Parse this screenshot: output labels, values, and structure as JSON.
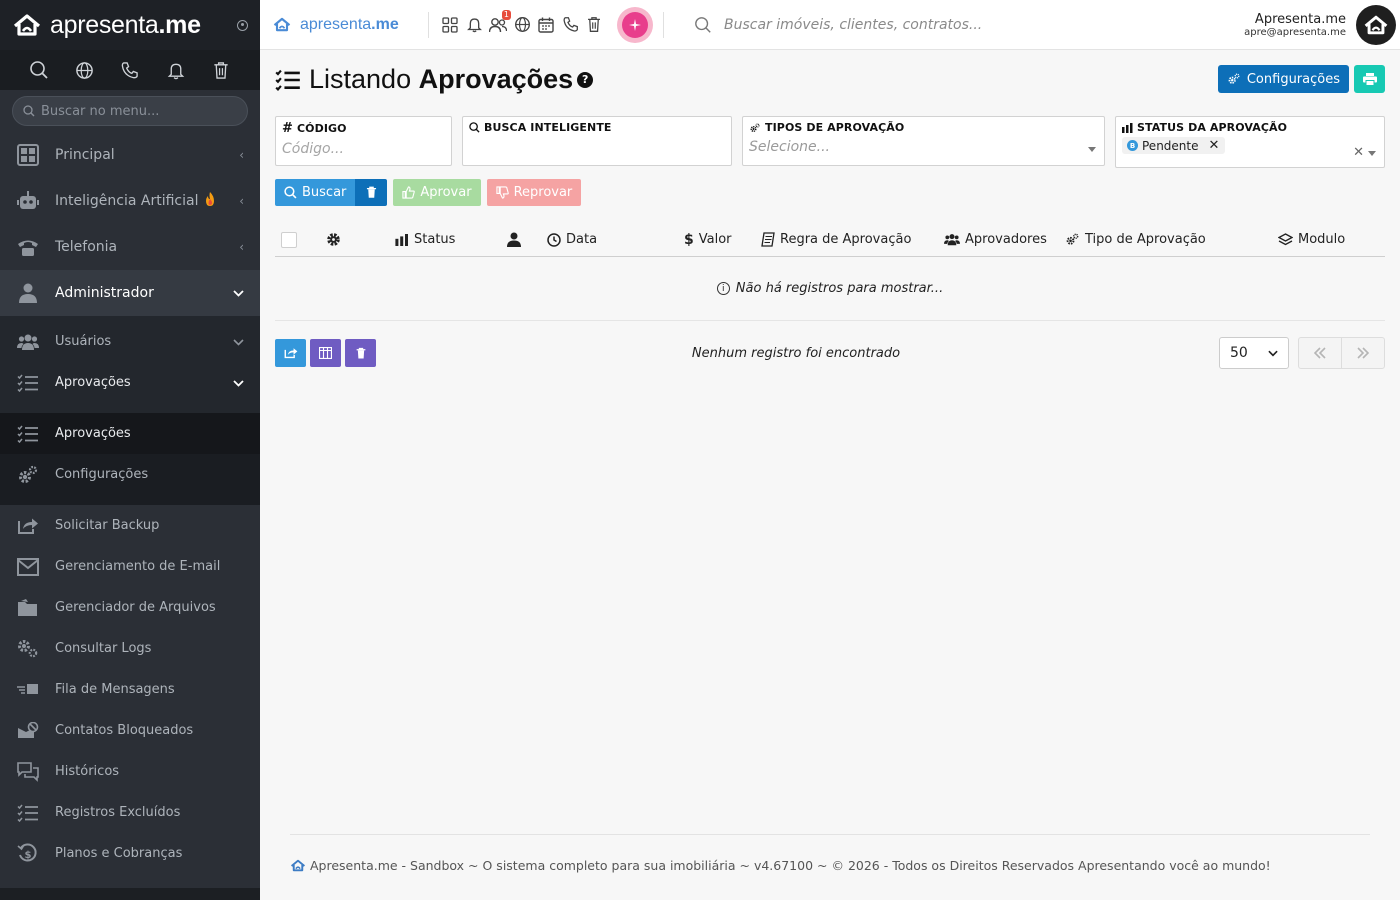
{
  "sidebar": {
    "brand": {
      "name_light": "apresenta",
      "name_bold": ".me"
    },
    "search_placeholder": "Buscar no menu...",
    "menu": [
      {
        "label": "Principal",
        "icon": "dashboard-icon"
      },
      {
        "label": "Inteligência Artificial",
        "icon": "robot-icon"
      },
      {
        "label": "Telefonia",
        "icon": "phone-icon"
      },
      {
        "label": "Administrador",
        "icon": "admin-user-icon"
      }
    ],
    "admin_submenu": [
      {
        "label": "Usuários",
        "icon": "users-icon"
      },
      {
        "label": "Aprovações",
        "icon": "checklist-icon"
      }
    ],
    "approvals_submenu": [
      {
        "label": "Aprovações",
        "icon": "checklist-icon"
      },
      {
        "label": "Configurações",
        "icon": "cogs-icon"
      }
    ],
    "more_items": [
      {
        "label": "Solicitar Backup",
        "icon": "share-icon"
      },
      {
        "label": "Gerenciamento de E-mail",
        "icon": "mail-icon"
      },
      {
        "label": "Gerenciador de Arquivos",
        "icon": "folder-icon"
      },
      {
        "label": "Consultar Logs",
        "icon": "cogs-icon"
      },
      {
        "label": "Fila de Mensagens",
        "icon": "queue-icon"
      },
      {
        "label": "Contatos Bloqueados",
        "icon": "blocked-contact-icon"
      },
      {
        "label": "Históricos",
        "icon": "history-chat-icon"
      },
      {
        "label": "Registros Excluídos",
        "icon": "list-icon"
      },
      {
        "label": "Planos e Cobranças",
        "icon": "billing-icon"
      }
    ]
  },
  "topbar": {
    "logo_light": "apresenta",
    "logo_bold": ".me",
    "notification_badge": "1",
    "search_placeholder": "Buscar imóveis, clientes, contratos...",
    "user_name": "Apresenta.me",
    "user_email": "apre@apresenta.me"
  },
  "page": {
    "title_prefix": "Listando",
    "title_bold": "Aprovações",
    "help": "?",
    "btn_config": "Configurações"
  },
  "filters": {
    "codigo": {
      "label": "Código",
      "placeholder": "Código..."
    },
    "busca": {
      "label": "Busca Inteligente",
      "placeholder": ""
    },
    "tipos": {
      "label": "Tipos de Aprovação",
      "placeholder": "Selecione..."
    },
    "status": {
      "label": "Status da Aprovação",
      "selected": "Pendente",
      "selected_badge": "B"
    }
  },
  "actions": {
    "search": "Buscar",
    "approve": "Aprovar",
    "reject": "Reprovar"
  },
  "table": {
    "columns": {
      "status": "Status",
      "data": "Data",
      "valor": "Valor",
      "regra": "Regra de Aprovação",
      "aprovadores": "Aprovadores",
      "tipo": "Tipo de Aprovação",
      "modulo": "Modulo"
    },
    "empty_message": "Não há registros para mostrar..."
  },
  "pagination": {
    "message": "Nenhum registro foi encontrado",
    "page_size": "50"
  },
  "footer": {
    "text": "Apresenta.me - Sandbox ~ O sistema completo para sua imobiliária ~ v4.67100 ~ © 2026 - Todos os Direitos Reservados Apresentando você ao mundo!"
  },
  "colors": {
    "sidebar_bg": "#2b2f36",
    "primary": "#0d6fb8",
    "info": "#3498db",
    "teal": "#17c9b3",
    "purple": "#6f5cc2",
    "ai_pink": "#e83e8c"
  }
}
